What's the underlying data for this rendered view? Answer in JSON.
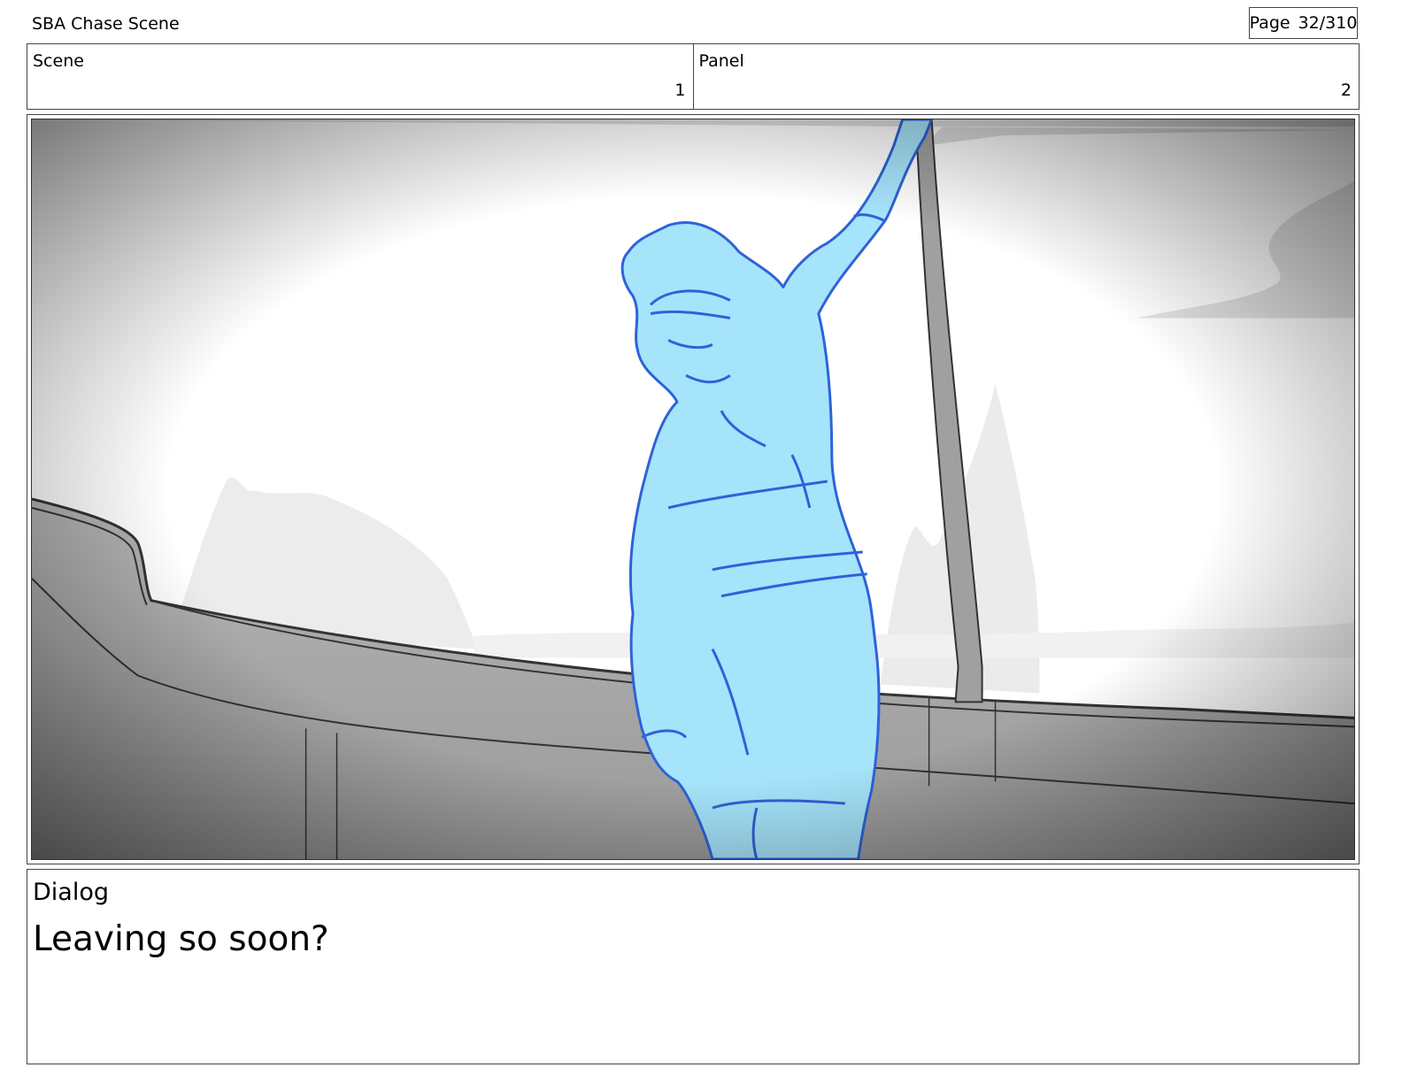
{
  "header": {
    "title": "SBA Chase Scene",
    "page_label": "Page",
    "page_value": "32/310"
  },
  "meta": {
    "scene_label": "Scene",
    "scene_value": "1",
    "panel_label": "Panel",
    "panel_value": "2"
  },
  "dialog": {
    "label": "Dialog",
    "text": "Leaving so soon?"
  },
  "colors": {
    "figure_fill": "#a6e4fb",
    "figure_line": "#2f62d9",
    "ship_gray": "#a9a9a9"
  }
}
